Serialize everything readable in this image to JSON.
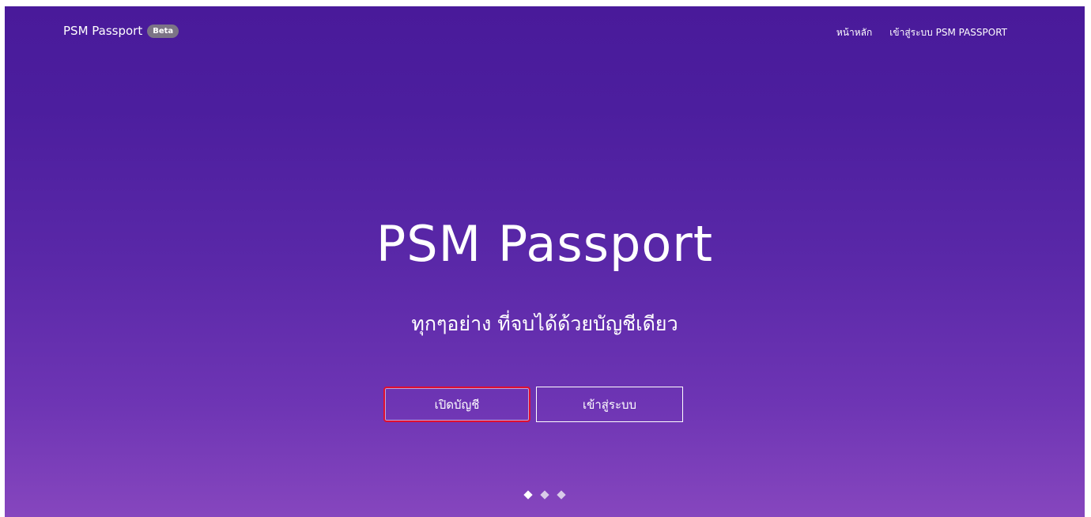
{
  "navbar": {
    "brand": "PSM Passport",
    "badge": "Beta",
    "links": [
      "หน้าหลัก",
      "เข้าสู่ระบบ PSM PASSPORT"
    ]
  },
  "hero": {
    "title": "PSM Passport",
    "subtitle": "ทุกๆอย่าง ที่จบได้ด้วยบัญชีเดียว",
    "register_label": "เปิดบัญชี",
    "login_label": "เข้าสู่ระบบ"
  },
  "carousel": {
    "slide_count": 3,
    "active_index": 0
  },
  "colors": {
    "background_top": "#491a9a",
    "background_bottom": "#8646be",
    "highlight_border": "#e00f2f"
  }
}
